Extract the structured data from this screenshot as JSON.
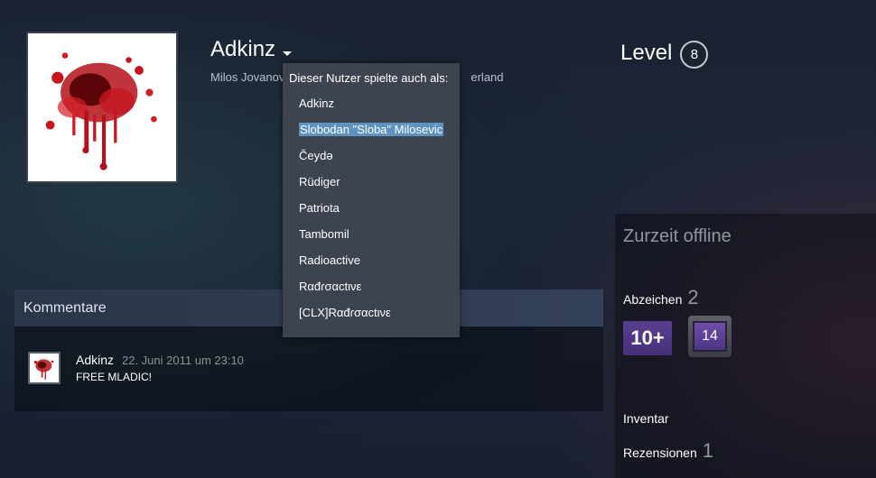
{
  "profile": {
    "persona_name": "Adkinz",
    "real_name_location": "Milos Jovanov",
    "real_name_location_tail": "erland"
  },
  "level": {
    "label": "Level",
    "value": "8"
  },
  "alias_dropdown": {
    "header": "Dieser Nutzer spielte auch als:",
    "items": [
      "Adkinz",
      "Slobodan \"Sloba\" Milosevic",
      "Čeydə",
      "Rüdiger",
      "Patriota",
      "Tambomil",
      "Radioactive",
      "Rαđɾσαctινε",
      "[CLX]Rαđɾσαctινε"
    ],
    "selected_index": 1
  },
  "comments": {
    "title": "Kommentare",
    "items": [
      {
        "author": "Adkinz",
        "date": "22. Juni 2011 um 23:10",
        "text": "FREE MLADIC!"
      }
    ]
  },
  "sidebar": {
    "status": "Zurzeit offline",
    "badges_label": "Abzeichen",
    "badges_count": "2",
    "badges": [
      {
        "text": "10+",
        "color": "#5b3f8f"
      },
      {
        "text": "14",
        "color": "#6e4fa8"
      }
    ],
    "inventory_label": "Inventar",
    "reviews_label": "Rezensionen",
    "reviews_count": "1"
  },
  "colors": {
    "selection": "#5e93c0",
    "dropdown_bg": "#3d4450"
  }
}
